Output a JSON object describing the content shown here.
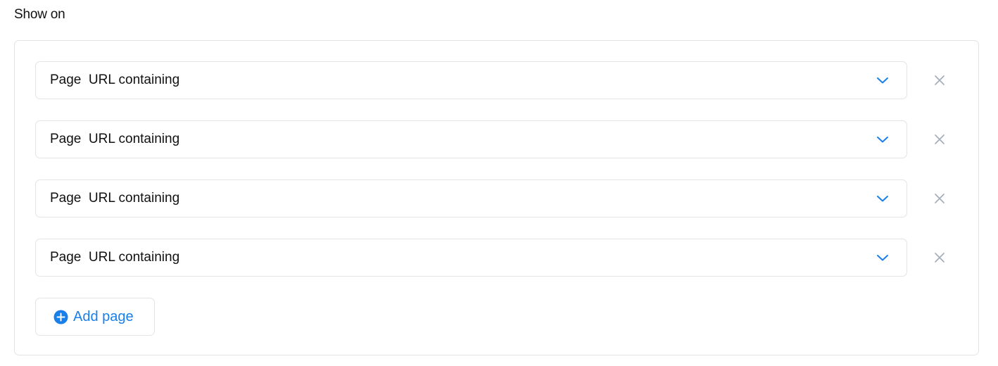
{
  "section": {
    "title": "Show on"
  },
  "rules": [
    {
      "value": "Page  URL containing"
    },
    {
      "value": "Page  URL containing"
    },
    {
      "value": "Page  URL containing"
    },
    {
      "value": "Page  URL containing"
    }
  ],
  "add_button": {
    "label": "Add page"
  },
  "icons": {
    "dropdown": "chevron-down-icon",
    "remove": "close-icon",
    "add": "plus-circle-icon"
  },
  "colors": {
    "accent": "#1a7fe8",
    "border": "#e2e4e8",
    "remove_icon": "#a9afba",
    "text": "#111111"
  }
}
